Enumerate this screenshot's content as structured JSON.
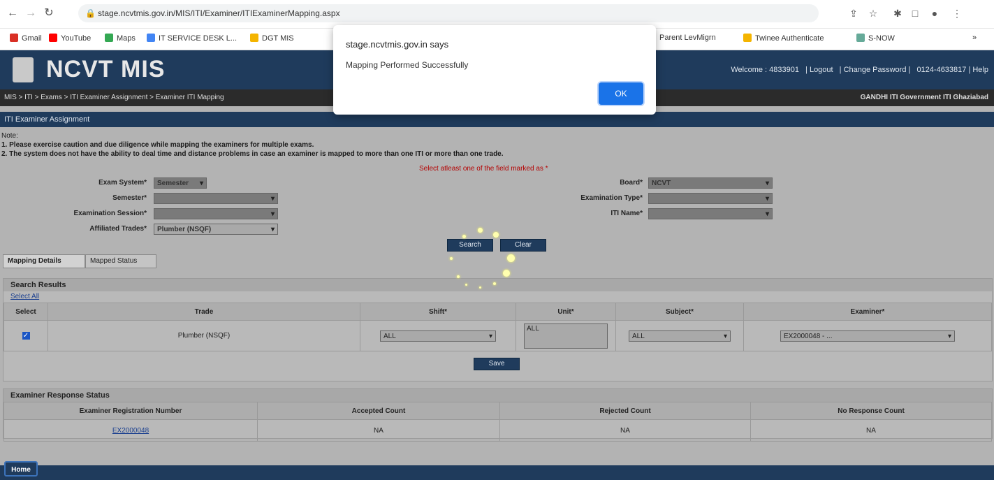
{
  "browser": {
    "url": "stage.ncvtmis.gov.in/MIS/ITI/Examiner/ITIExaminerMapping.aspx",
    "bookmarks": [
      "Gmail",
      "YouTube",
      "Maps",
      "IT SERVICE DESK L...",
      "DGT MIS",
      "Parent LevMigrn",
      "Twinee Authenticate",
      "S-NOW"
    ]
  },
  "app": {
    "logo": "NCVT MIS",
    "top_links": [
      "Welcome : 4833901",
      "| Logout",
      "| Change Password |",
      "0124-4633817 | Help"
    ],
    "breadcrumb": "MIS > ITI > Exams > ITI Examiner Assignment > Examiner ITI Mapping",
    "institute": "GANDHI ITI Government ITI Ghaziabad",
    "section_title": "ITI Examiner Assignment"
  },
  "notes": {
    "title": "Note:",
    "line1": "1. Please exercise caution and due diligence while mapping the examiners for multiple exams.",
    "line2": "2. The system does not have the ability to deal time and distance problems in case an examiner is mapped to more than one ITI or more than one trade.",
    "required": "Select atleast one of the field marked as *"
  },
  "form": {
    "exam_system_label": "Exam System*",
    "exam_system_value": "Semester",
    "semester_label": "Semester*",
    "semester_value": "",
    "exam_session_label": "Examination Session*",
    "exam_session_value": "",
    "affiliated_trades_label": "Affiliated Trades*",
    "affiliated_trades_value": "Plumber (NSQF)",
    "board_label": "Board*",
    "board_value": "NCVT",
    "exam_type_label": "Examination Type*",
    "exam_type_value": "",
    "iti_name_label": "ITI Name*",
    "iti_name_value": "",
    "search_btn": "Search",
    "clear_btn": "Clear"
  },
  "tabs": [
    "Mapping Details",
    "Mapped Status"
  ],
  "search_results": {
    "title": "Search Results",
    "link": "Select All",
    "headers": [
      "Select",
      "Trade",
      "Shift*",
      "Unit*",
      "Subject*",
      "Examiner*"
    ],
    "row": {
      "trade": "Plumber (NSQF)",
      "shift": "ALL",
      "unit": "ALL",
      "subject": "ALL",
      "examiner": "EX2000048 - ..."
    },
    "save_btn": "Save"
  },
  "examiner_status": {
    "title": "Examiner Response Status",
    "headers": [
      "Examiner Registration Number",
      "Accepted Count",
      "Rejected Count",
      "No Response Count"
    ],
    "row": {
      "registration": "EX2000048",
      "accepted": "NA",
      "rejected": "NA",
      "no_response": "NA"
    }
  },
  "footer": {
    "home": "Home"
  },
  "dialog": {
    "title": "stage.ncvtmis.gov.in says",
    "message": "Mapping Performed Successfully",
    "ok": "OK",
    "accent": "#1a73e8"
  }
}
